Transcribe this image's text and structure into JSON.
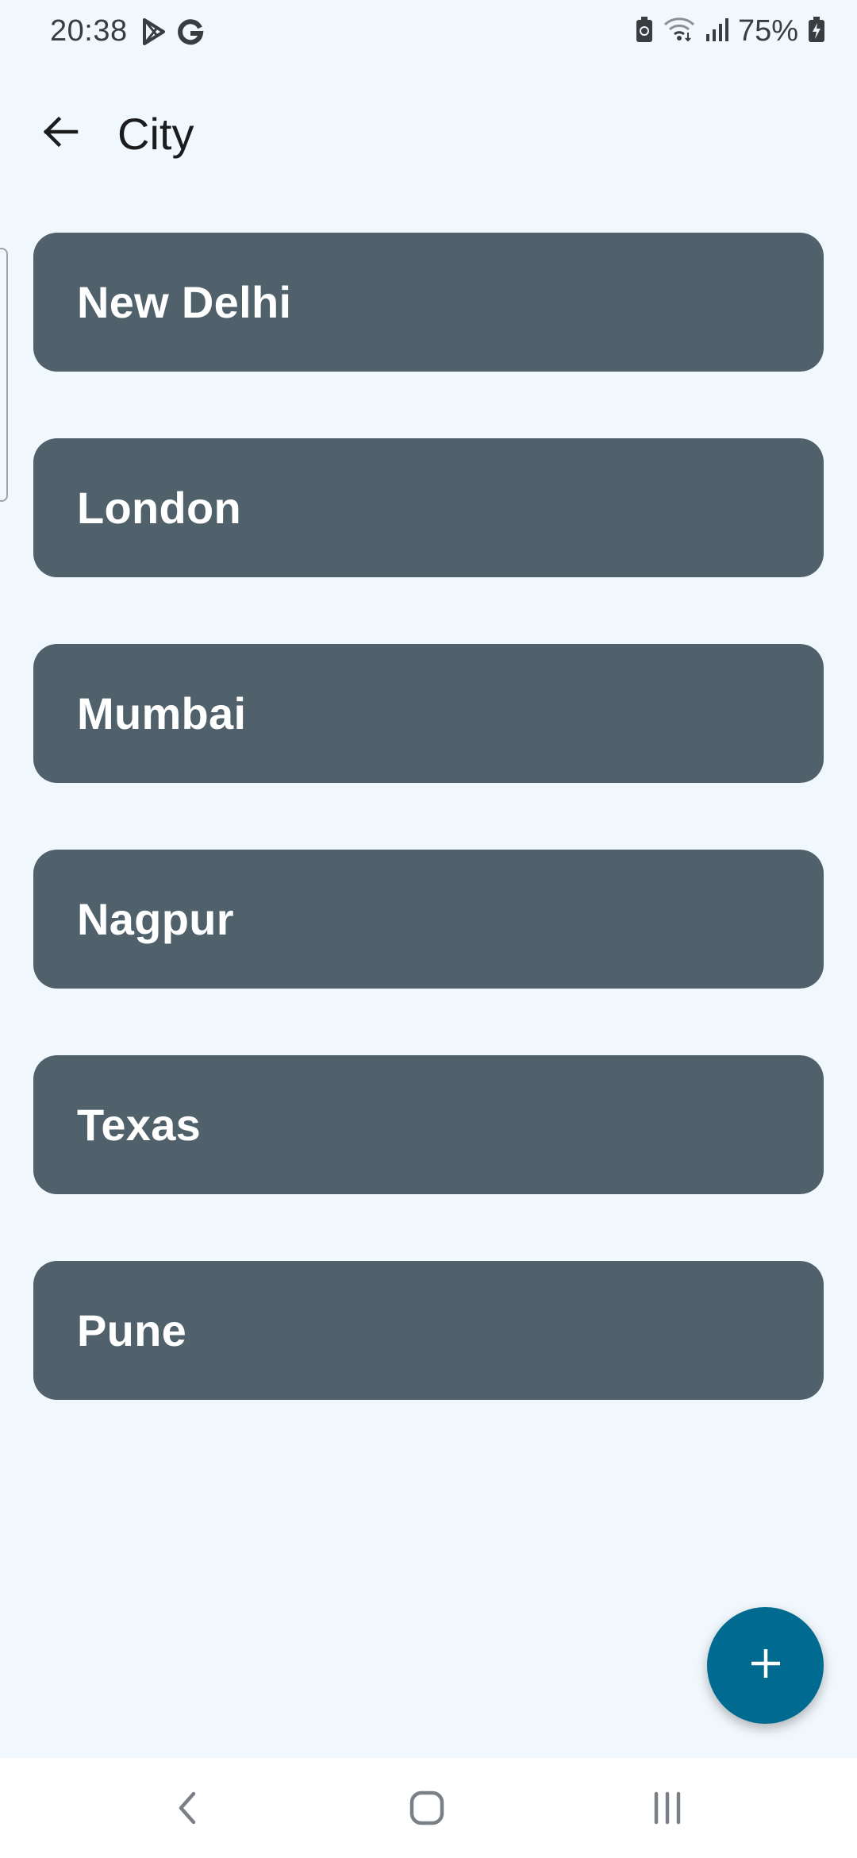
{
  "status_bar": {
    "time": "20:38",
    "battery_percent": "75%",
    "left_icons": [
      "play-store-icon",
      "google-icon"
    ],
    "right_icons": [
      "battery-saver-icon",
      "wifi-icon",
      "signal-icon",
      "battery-charging-icon"
    ]
  },
  "app_bar": {
    "title": "City",
    "back_icon": "arrow-left-icon"
  },
  "cities": [
    {
      "name": "New Delhi"
    },
    {
      "name": "London"
    },
    {
      "name": "Mumbai"
    },
    {
      "name": "Nagpur"
    },
    {
      "name": "Texas"
    },
    {
      "name": "Pune"
    }
  ],
  "fab": {
    "icon": "plus-icon"
  },
  "nav_bar": {
    "icons": [
      "nav-back-icon",
      "nav-home-icon",
      "nav-recents-icon"
    ]
  },
  "colors": {
    "background": "#f1f8fd",
    "card": "#50616c",
    "card_text": "#ffffff",
    "fab": "#006a91",
    "nav_bar": "#ffffff"
  }
}
